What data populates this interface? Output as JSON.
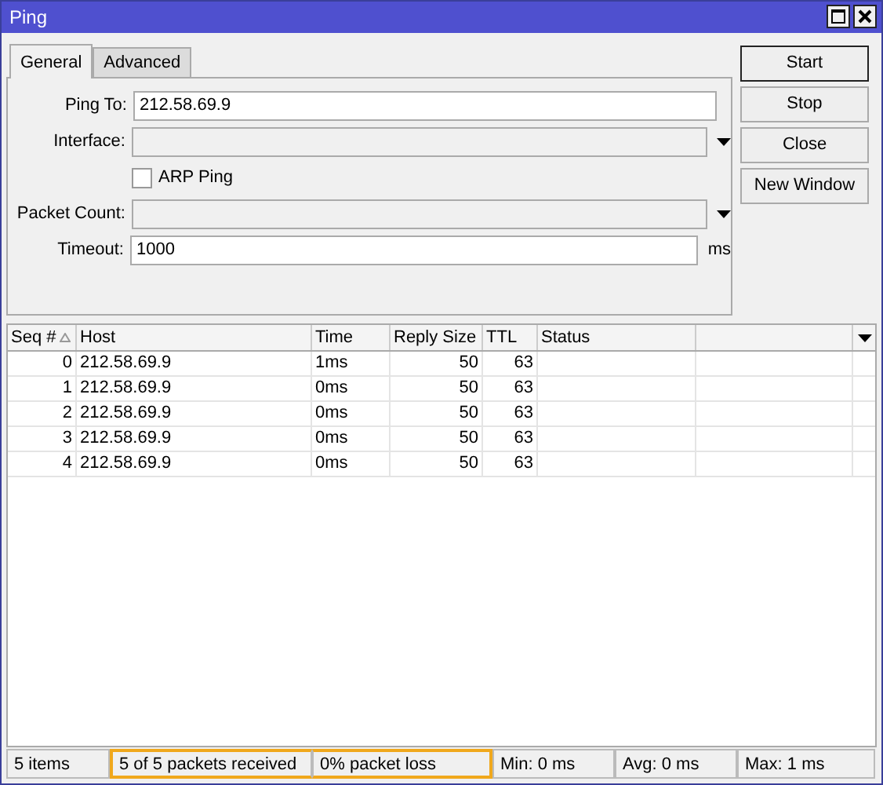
{
  "window": {
    "title": "Ping"
  },
  "tabs": [
    {
      "label": "General",
      "selected": true
    },
    {
      "label": "Advanced",
      "selected": false
    }
  ],
  "form": [
    {
      "kind": "text",
      "label": "Ping To:",
      "value": "212.58.69.9"
    },
    {
      "kind": "dropdown",
      "label": "Interface:"
    },
    {
      "kind": "checkbox",
      "label": "ARP Ping",
      "checked": false
    },
    {
      "kind": "dropdown",
      "label": "Packet Count:"
    },
    {
      "kind": "text",
      "label": "Timeout:",
      "value": "1000",
      "unit": "ms"
    }
  ],
  "buttons": [
    "Start",
    "Stop",
    "Close",
    "New Window"
  ],
  "table": {
    "columns": [
      {
        "label": "Seq #",
        "sorted": true
      },
      {
        "label": "Host",
        "sorted": false
      },
      {
        "label": "Time",
        "sorted": false
      },
      {
        "label": "Reply Size",
        "sorted": false
      },
      {
        "label": "TTL",
        "sorted": false
      },
      {
        "label": "Status",
        "sorted": false
      }
    ],
    "rows": [
      [
        "0",
        "212.58.69.9",
        "1ms",
        "50",
        "63",
        ""
      ],
      [
        "1",
        "212.58.69.9",
        "0ms",
        "50",
        "63",
        ""
      ],
      [
        "2",
        "212.58.69.9",
        "0ms",
        "50",
        "63",
        ""
      ],
      [
        "3",
        "212.58.69.9",
        "0ms",
        "50",
        "63",
        ""
      ],
      [
        "4",
        "212.58.69.9",
        "0ms",
        "50",
        "63",
        ""
      ]
    ]
  },
  "status_bar": [
    {
      "text": "5 items",
      "highlighted": false
    },
    {
      "text": "5 of 5 packets received",
      "highlighted": true
    },
    {
      "text": "0% packet loss",
      "highlighted": true
    },
    {
      "text": "Min: 0 ms",
      "highlighted": false
    },
    {
      "text": "Avg: 0 ms",
      "highlighted": false
    },
    {
      "text": "Max: 1 ms",
      "highlighted": false
    }
  ]
}
